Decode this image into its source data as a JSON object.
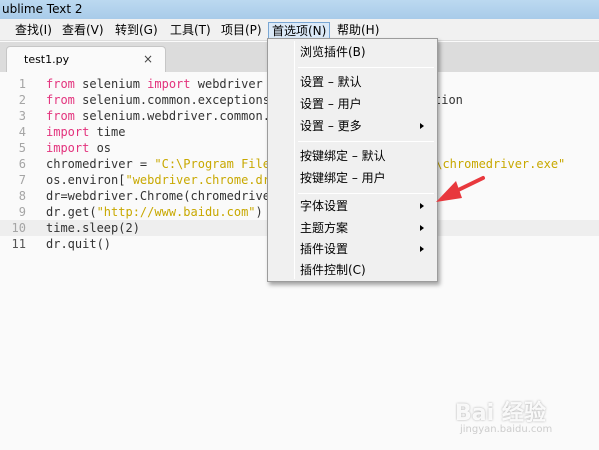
{
  "window": {
    "title": "ublime Text 2"
  },
  "menubar": {
    "items": [
      "查找(I)",
      "查看(V)",
      "转到(G)",
      "工具(T)",
      "项目(P)",
      "首选项(N)",
      "帮助(H)"
    ],
    "active_index": 5
  },
  "tab": {
    "label": "test1.py",
    "close": "×"
  },
  "editor": {
    "line_numbers": [
      "1",
      "2",
      "3",
      "4",
      "5",
      "6",
      "7",
      "8",
      "9",
      "10",
      "11"
    ],
    "current_line": 11,
    "lines": [
      "from selenium import webdriver",
      "from selenium.common.exceptions",
      "from selenium.webdriver.common.k",
      "import time",
      "import os",
      "chromedriver = \"C:\\Program Files",
      "os.environ[\"webdriver.chrome.dri",
      "dr=webdriver.Chrome(chromedriver",
      "dr.get(\"http://www.baidu.com\")",
      "time.sleep(2)",
      "dr.quit()"
    ],
    "overflow_fragments": {
      "line2": "tion",
      "line6": "n\\chromedriver.exe\""
    }
  },
  "dropdown": {
    "items": [
      {
        "label": "浏览插件(B)",
        "submenu": false
      },
      {
        "label": "设置 – 默认",
        "submenu": false
      },
      {
        "label": "设置 – 用户",
        "submenu": false
      },
      {
        "label": "设置 – 更多",
        "submenu": true
      },
      {
        "label": "按键绑定 – 默认",
        "submenu": false
      },
      {
        "label": "按键绑定 – 用户",
        "submenu": false
      },
      {
        "label": "字体设置",
        "submenu": true
      },
      {
        "label": "主题方案",
        "submenu": true
      },
      {
        "label": "插件设置",
        "submenu": true
      },
      {
        "label": "插件控制(C)",
        "submenu": false
      }
    ]
  },
  "annotation": {
    "color": "#e8383d"
  },
  "watermark": {
    "logo": "Bai 经验",
    "url": "jingyan.baidu.com"
  }
}
